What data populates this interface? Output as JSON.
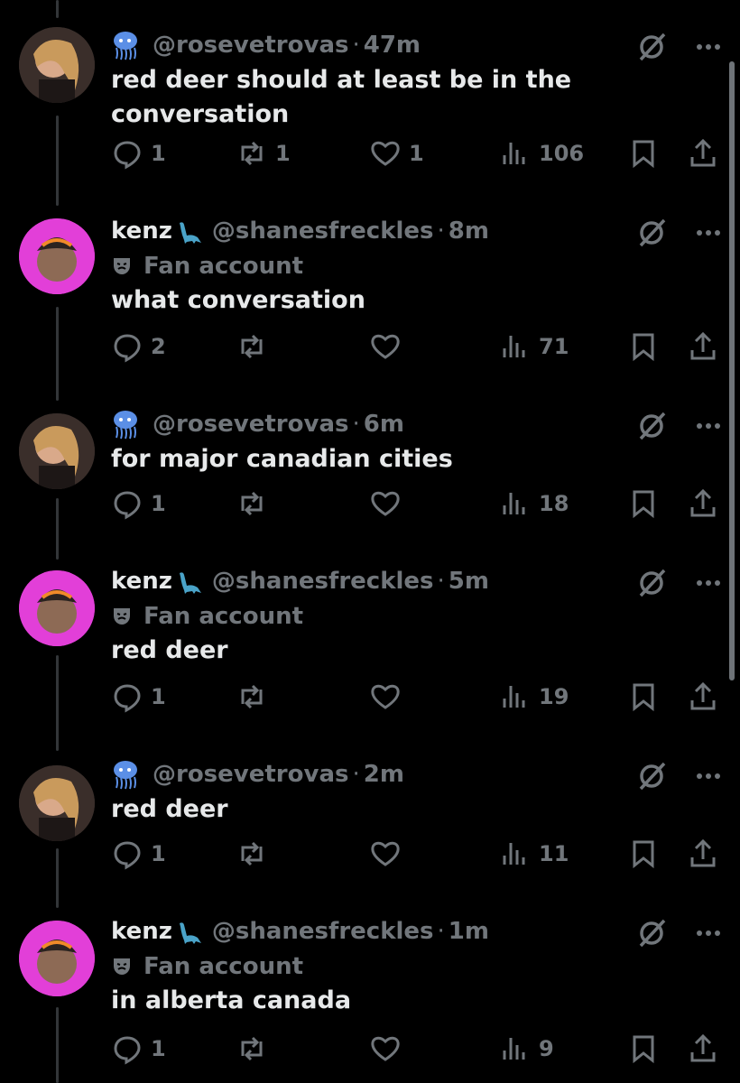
{
  "posts": [
    {
      "author": "rosevetrovas",
      "display_name": "",
      "handle": "@rosevetrovas",
      "sep": "·",
      "time": "47m",
      "fan_account": "",
      "text": "red deer should at least be in the conversation",
      "replies": "1",
      "reposts": "1",
      "likes": "1",
      "views": "106"
    },
    {
      "author": "kenz",
      "display_name": "kenz",
      "handle": "@shanesfreckles",
      "sep": "·",
      "time": "8m",
      "fan_account": "Fan account",
      "text": "what conversation",
      "replies": "2",
      "reposts": "",
      "likes": "",
      "views": "71"
    },
    {
      "author": "rosevetrovas",
      "display_name": "",
      "handle": "@rosevetrovas",
      "sep": "·",
      "time": "6m",
      "fan_account": "",
      "text": "for major canadian cities",
      "replies": "1",
      "reposts": "",
      "likes": "",
      "views": "18"
    },
    {
      "author": "kenz",
      "display_name": "kenz",
      "handle": "@shanesfreckles",
      "sep": "·",
      "time": "5m",
      "fan_account": "Fan account",
      "text": "red deer",
      "replies": "1",
      "reposts": "",
      "likes": "",
      "views": "19"
    },
    {
      "author": "rosevetrovas",
      "display_name": "",
      "handle": "@rosevetrovas",
      "sep": "·",
      "time": "2m",
      "fan_account": "",
      "text": "red deer",
      "replies": "1",
      "reposts": "",
      "likes": "",
      "views": "11"
    },
    {
      "author": "kenz",
      "display_name": "kenz",
      "handle": "@shanesfreckles",
      "sep": "·",
      "time": "1m",
      "fan_account": "Fan account",
      "text": "in alberta canada",
      "replies": "1",
      "reposts": "",
      "likes": "",
      "views": "9"
    }
  ],
  "icons": {
    "badge_rose": "jellyfish-icon",
    "badge_kenz": "dinosaur-icon",
    "fan": "theater-mask-icon",
    "reply": "reply-icon",
    "repost": "repost-icon",
    "like": "heart-icon",
    "views": "views-icon",
    "bookmark": "bookmark-icon",
    "share": "share-icon",
    "grok": "grok-icon",
    "more": "more-icon"
  },
  "colors": {
    "background": "#000000",
    "text": "#e7e9ea",
    "muted": "#71767b",
    "thread_line": "#333639",
    "avatar_ring_kenz": "#e23fd8"
  }
}
